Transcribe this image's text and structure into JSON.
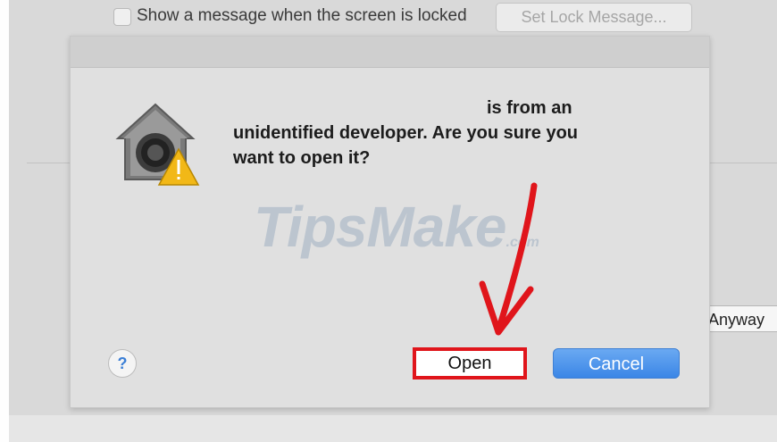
{
  "background": {
    "lock_message_checkbox_label": "Show a message when the screen is locked",
    "set_lock_message_button": "Set Lock Message...",
    "allow_anyway_button": "Anyway"
  },
  "dialog": {
    "icon": "gatekeeper-warning-icon",
    "message_line1": "is from an",
    "message_line2": "unidentified developer. Are you sure you",
    "message_line3": "want to open it?",
    "help_button": "?",
    "open_button": "Open",
    "cancel_button": "Cancel"
  },
  "watermark": {
    "text": "TipsMake",
    "suffix": ".com"
  },
  "colors": {
    "highlight_box": "#e0151b",
    "arrow": "#e0151b",
    "cancel_button": "#3b86e6"
  }
}
